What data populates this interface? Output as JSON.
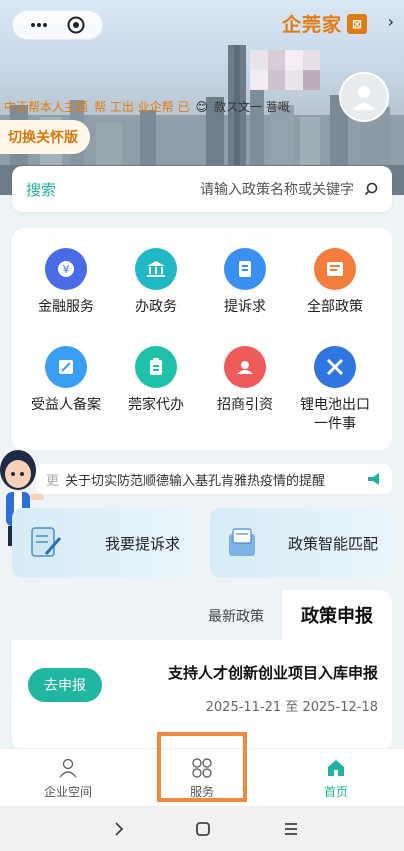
{
  "header": {
    "brand_name": "企莞家",
    "brand_logo_glyph": "⊠",
    "user_name": "款ス文一 菩嘅",
    "user_tags_left": "中正帮本人主题",
    "user_tags_mid": "帮 工出 业企帮 已",
    "care_mode_label": "切换关怀版"
  },
  "search": {
    "button_label": "搜索",
    "placeholder": "请输入政策名称或关键字"
  },
  "services": [
    {
      "label": "全部政策"
    },
    {
      "label": "提诉求"
    },
    {
      "label": "办政务"
    },
    {
      "label": "金融服务"
    },
    {
      "label": "锂电池出口\n一件事"
    },
    {
      "label": "招商引资"
    },
    {
      "label": "莞家代办"
    },
    {
      "label": "受益人备案"
    }
  ],
  "notice": {
    "text": "关于切实防范顺德输入基孔肯雅热疫情的提醒",
    "more": "更"
  },
  "cards": {
    "left_label": "我要提诉求",
    "right_label": "政策智能匹配"
  },
  "policy": {
    "title": "政策申报",
    "tab_latest": "最新政策",
    "item_title": "支持人才创新创业项目入库申报",
    "item_date": "2025-11-21 至 2025-12-18",
    "apply_button": "去申报"
  },
  "tabbar": {
    "home": "首页",
    "service": "服务",
    "enterprise": "企业空间"
  },
  "colors": {
    "accent": "#1fb39c",
    "brand_orange": "#e07b12",
    "highlight": "#f08a3c"
  }
}
